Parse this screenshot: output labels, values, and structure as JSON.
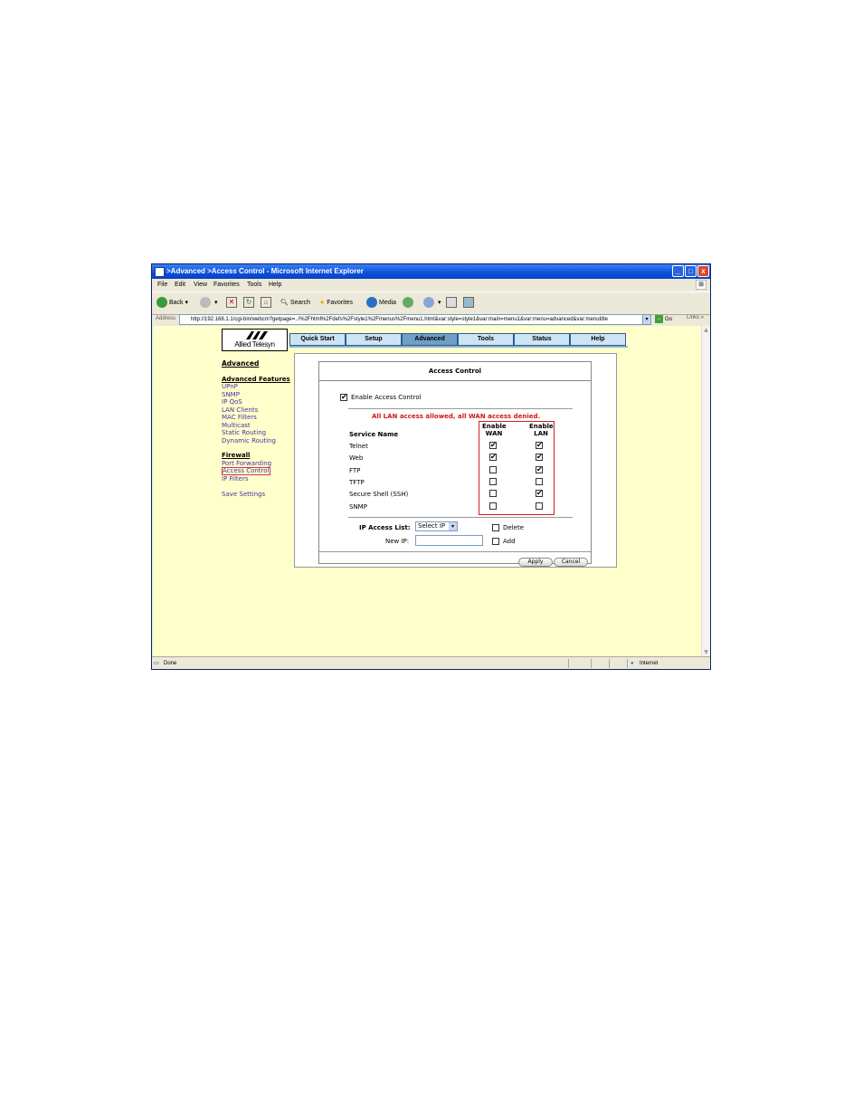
{
  "window": {
    "title": ">Advanced >Access Control - Microsoft Internet Explorer",
    "minimize": "_",
    "maximize": "□",
    "close": "x"
  },
  "menu": [
    "File",
    "Edit",
    "View",
    "Favorites",
    "Tools",
    "Help"
  ],
  "toolbar": {
    "back": "Back",
    "search": "Search",
    "favorites": "Favorites",
    "media": "Media"
  },
  "address": {
    "label": "Address",
    "url": "http://192.168.1.1/cgi-bin/webcm?getpage=../%2Fhtml%2Fdefs%2Fstyle1%2Fmenus%2Fmenu1.html&var:style=style1&var:main=menu1&var:menu=advanced&var:menutitle",
    "go": "Go",
    "links": "Links"
  },
  "logo": {
    "text": "Allied Telesyn"
  },
  "nav_tabs": [
    {
      "label": "Quick Start"
    },
    {
      "label": "Setup"
    },
    {
      "label": "Advanced"
    },
    {
      "label": "Tools"
    },
    {
      "label": "Status"
    },
    {
      "label": "Help"
    }
  ],
  "sidebar": {
    "advanced": "Advanced",
    "advanced_features": "Advanced Features",
    "features": [
      "UPnP",
      "SNMP",
      "IP QoS",
      "LAN Clients",
      "MAC Filters",
      "Multicast",
      "Static Routing",
      "Dynamic Routing"
    ],
    "firewall": "Firewall",
    "firewall_items": [
      "Port Forwarding",
      "Access Control",
      "IP Filters"
    ],
    "save": "Save Settings"
  },
  "panel": {
    "title": "Access Control",
    "enable_label": "Enable Access Control",
    "enable_checked": "✔",
    "notice": "All LAN access allowed, all WAN access denied.",
    "col_service": "Service Name",
    "col_wan_1": "Enable",
    "col_wan_2": "WAN",
    "col_lan_1": "Enable",
    "col_lan_2": "LAN",
    "services": [
      {
        "name": "Telnet",
        "wan": "✔",
        "lan": "✔"
      },
      {
        "name": "Web",
        "wan": "✔",
        "lan": "✔"
      },
      {
        "name": "FTP",
        "wan": "",
        "lan": "✔"
      },
      {
        "name": "TFTP",
        "wan": "",
        "lan": ""
      },
      {
        "name": "Secure Shell (SSH)",
        "wan": "",
        "lan": "✔"
      },
      {
        "name": "SNMP",
        "wan": "",
        "lan": ""
      }
    ],
    "ip_list_label": "IP Access List:",
    "ip_select": "Select IP",
    "delete_label": "Delete",
    "new_ip_label": "New IP:",
    "add_label": "Add",
    "apply": "Apply",
    "cancel": "Cancel"
  },
  "status": {
    "left": "Done",
    "zone": "Internet"
  }
}
